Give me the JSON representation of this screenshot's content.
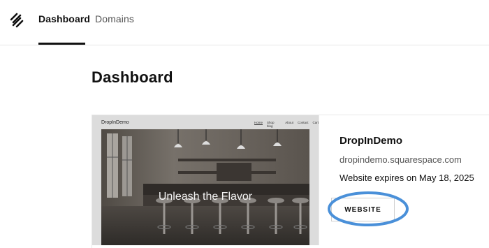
{
  "nav": {
    "logo_icon": "squarespace-logo-icon",
    "tabs": [
      {
        "label": "Dashboard",
        "active": true
      },
      {
        "label": "Domains",
        "active": false
      }
    ]
  },
  "page": {
    "title": "Dashboard"
  },
  "site_card": {
    "thumbnail": {
      "site_name": "DropInDemo",
      "nav_items": [
        "Home",
        "Shop blog",
        "About",
        "Contact",
        "Cart"
      ],
      "hero_text": "Unleash the Flavor"
    },
    "name": "DropInDemo",
    "url": "dropindemo.squarespace.com",
    "expiry": "Website expires on May 18, 2025",
    "button_label": "WEBSITE"
  },
  "colors": {
    "highlight_ring": "#4a90d9",
    "active_tab": "#111111"
  }
}
